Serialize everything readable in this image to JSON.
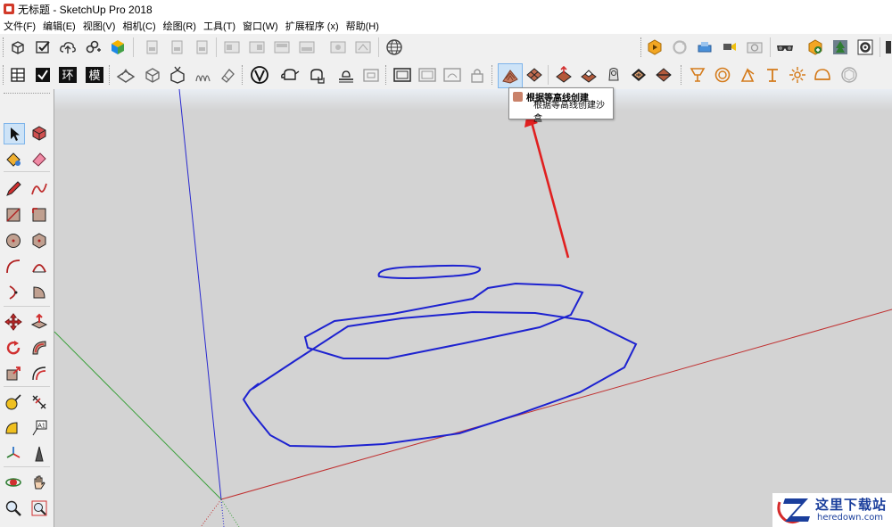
{
  "window": {
    "title": "无标题 - SketchUp Pro 2018"
  },
  "menu": {
    "items": [
      "文件(F)",
      "编辑(E)",
      "视图(V)",
      "相机(C)",
      "绘图(R)",
      "工具(T)",
      "窗口(W)",
      "扩展程序 (x)",
      "帮助(H)"
    ]
  },
  "tooltip": {
    "line1": "根据等高线创建",
    "line2": "根据等高线创建沙盒"
  },
  "watermark": {
    "brand": "这里下载站",
    "domain": "heredown.com"
  },
  "colors": {
    "accent_red": "#e02020",
    "stroke_blue": "#1d22d0",
    "canvas": "#d3d3d3",
    "watermark_blue": "#1a3e9c"
  },
  "icons": {
    "toolbar1": [
      "model-info-icon",
      "check-icon",
      "cloud-upload-icon",
      "link-icon",
      "colorful-cube-icon",
      "file-icon",
      "file-icon",
      "file-icon",
      "layout-icon",
      "layout-icon",
      "layout-icon",
      "layout-icon",
      "layout-icon",
      "layout-icon",
      "globe-icon",
      "extension-warehouse-icon",
      "refresh-icon",
      "send-icon",
      "camera-move-icon",
      "camera-icon",
      "goggles-icon",
      "add-location-icon",
      "tree-icon",
      "gear-icon"
    ],
    "toolbar2": [
      "outliner-icon",
      "checkmark-icon",
      "huan-icon",
      "mo-icon",
      "section-plane-icon",
      "cube-icon",
      "cube-arrow-icon",
      "smooth-icon",
      "eraser-soft-icon",
      "v-ray-icon",
      "teapot-icon",
      "teapot-hand-icon",
      "render-settings-icon",
      "render-region-icon",
      "frame-icon",
      "frame-icon",
      "frame-icon",
      "lock-icon",
      "sandbox-from-contours-icon",
      "sandbox-from-scratch-icon",
      "smoove-icon",
      "stamp-icon",
      "drape-icon",
      "add-detail-icon",
      "flip-edge-icon",
      "spot-light-icon",
      "omni-light-icon",
      "rect-light-icon",
      "ies-light-icon",
      "mesh-light-icon",
      "dome-light-icon",
      "sphere-icon"
    ],
    "leftbar": [
      "select-arrow-icon",
      "make-component-icon",
      "paint-bucket-icon",
      "eraser-icon",
      "pencil-icon",
      "freehand-icon",
      "rectangle-icon",
      "rotated-rect-icon",
      "circle-icon",
      "polygon-icon",
      "arc-icon",
      "arc-2pt-icon",
      "arc-3pt-icon",
      "pie-icon",
      "move-icon",
      "push-pull-icon",
      "rotate-icon",
      "follow-me-icon",
      "scale-icon",
      "offset-icon",
      "tape-measure-icon",
      "dimension-icon",
      "protractor-icon",
      "text-icon",
      "axes-icon",
      "3d-text-icon",
      "orbit-icon",
      "pan-icon",
      "zoom-icon",
      "zoom-window-icon"
    ]
  }
}
